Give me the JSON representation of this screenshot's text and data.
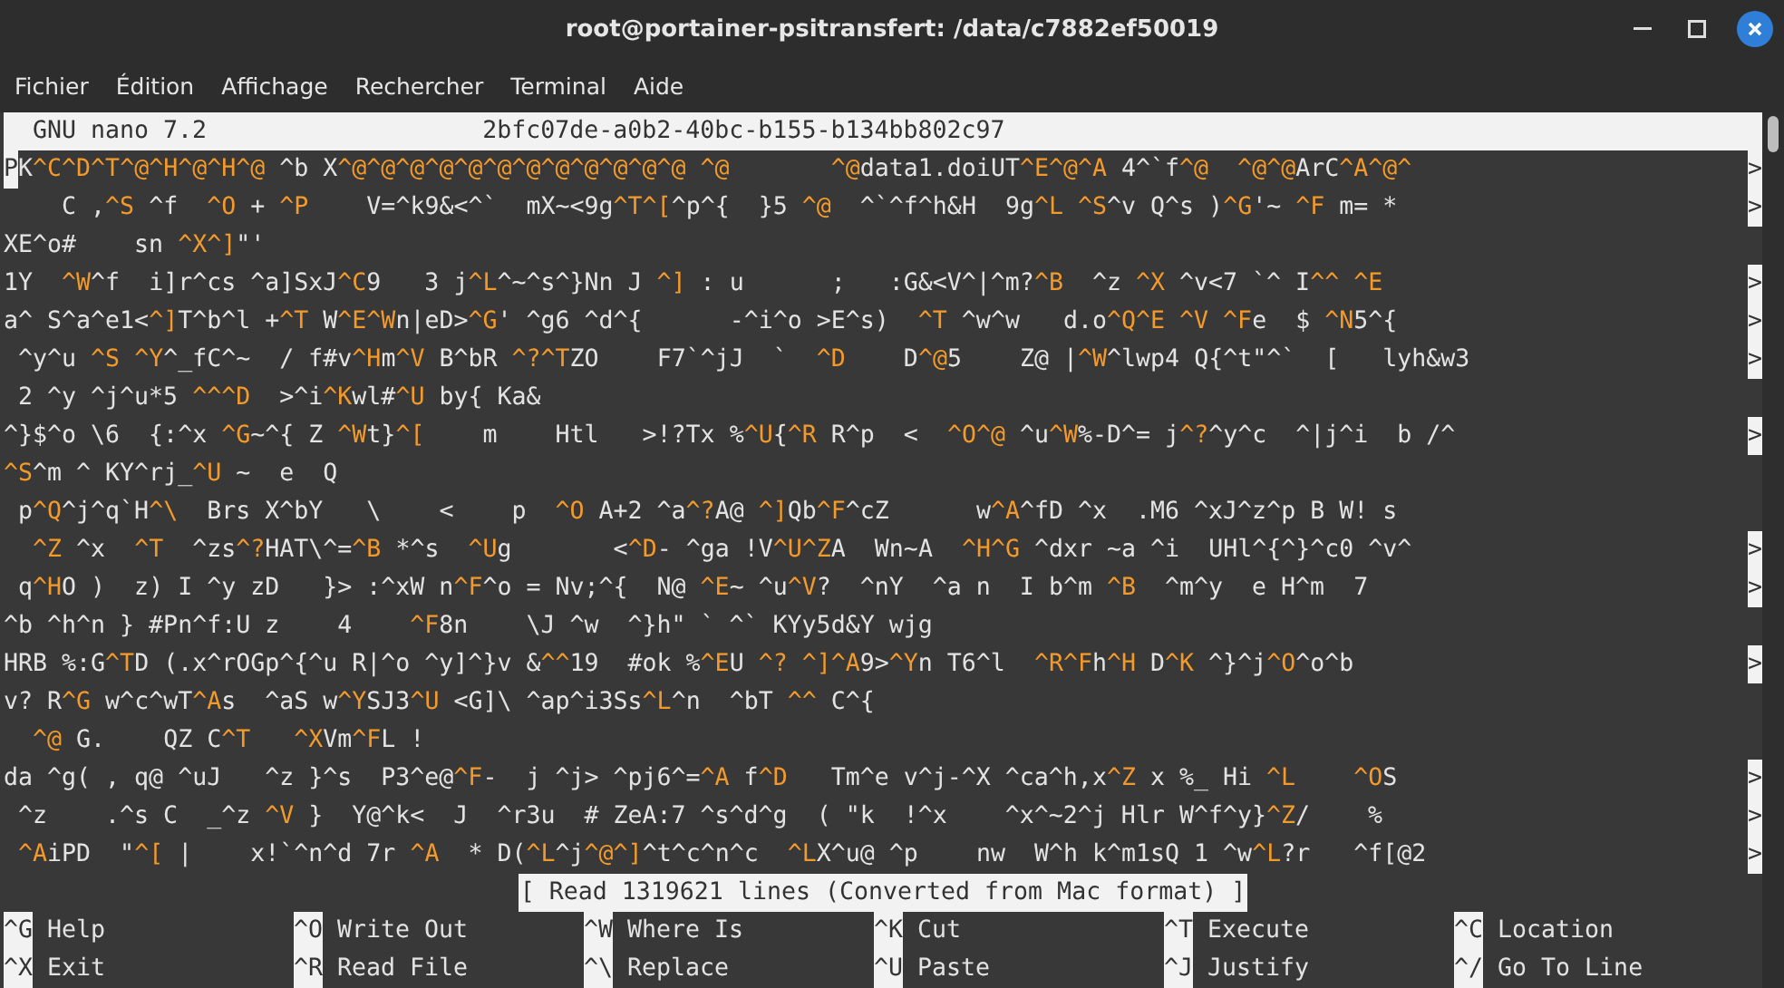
{
  "window": {
    "title": "root@portainer-psitransfert: /data/c7882ef50019"
  },
  "menu": [
    {
      "label": "Fichier"
    },
    {
      "label": "Édition"
    },
    {
      "label": "Affichage"
    },
    {
      "label": "Rechercher"
    },
    {
      "label": "Terminal"
    },
    {
      "label": "Aide"
    }
  ],
  "nano_header": {
    "version": "GNU nano 7.2",
    "filename": "2bfc07de-a0b2-40bc-b155-b134bb802c97"
  },
  "lines": [
    {
      "more": true,
      "segments": [
        {
          "kind": "cursor",
          "text": "P"
        },
        {
          "kind": "text",
          "text": "K"
        },
        {
          "kind": "ctrl",
          "text": "^C^D^T^@^H^@^H^@"
        },
        {
          "kind": "text",
          "text": " ^b X"
        },
        {
          "kind": "ctrl",
          "text": "^@^@^@^@^@^@^@^@^@^@^@^@"
        },
        {
          "kind": "ctrl",
          "text": " ^@"
        },
        {
          "kind": "ctrl",
          "text": "       ^@"
        },
        {
          "kind": "text",
          "text": "data1.doiUT"
        },
        {
          "kind": "ctrl",
          "text": "^E^@^A"
        },
        {
          "kind": "text",
          "text": " 4^`f"
        },
        {
          "kind": "ctrl",
          "text": "^@"
        },
        {
          "kind": "ctrl",
          "text": "  ^@^@"
        },
        {
          "kind": "text",
          "text": "ArC"
        },
        {
          "kind": "ctrl",
          "text": "^A^@^"
        }
      ]
    },
    {
      "more": true,
      "segments": [
        {
          "kind": "text",
          "text": "    C ,"
        },
        {
          "kind": "ctrl",
          "text": "^S"
        },
        {
          "kind": "text",
          "text": " ^f  "
        },
        {
          "kind": "ctrl",
          "text": "^O"
        },
        {
          "kind": "text",
          "text": " + "
        },
        {
          "kind": "ctrl",
          "text": "^P"
        },
        {
          "kind": "text",
          "text": "    V=^k9&<^`  mX~<9g"
        },
        {
          "kind": "ctrl",
          "text": "^T^["
        },
        {
          "kind": "text",
          "text": "^p^{  }5 "
        },
        {
          "kind": "ctrl",
          "text": "^@"
        },
        {
          "kind": "text",
          "text": "  ^`^f^h&H  9g"
        },
        {
          "kind": "ctrl",
          "text": "^L"
        },
        {
          "kind": "ctrl",
          "text": " ^S"
        },
        {
          "kind": "text",
          "text": "^v Q^s )"
        },
        {
          "kind": "ctrl",
          "text": "^G"
        },
        {
          "kind": "text",
          "text": "'~ "
        },
        {
          "kind": "ctrl",
          "text": "^F"
        },
        {
          "kind": "text",
          "text": " m= *"
        }
      ]
    },
    {
      "more": false,
      "segments": [
        {
          "kind": "text",
          "text": "XE^o#    sn "
        },
        {
          "kind": "ctrl",
          "text": "^X^]"
        },
        {
          "kind": "text",
          "text": "\"'"
        }
      ]
    },
    {
      "more": true,
      "segments": [
        {
          "kind": "text",
          "text": "1Y  "
        },
        {
          "kind": "ctrl",
          "text": "^W"
        },
        {
          "kind": "text",
          "text": "^f  i]r^cs ^a]SxJ"
        },
        {
          "kind": "ctrl",
          "text": "^C"
        },
        {
          "kind": "text",
          "text": "9   3 j"
        },
        {
          "kind": "ctrl",
          "text": "^L"
        },
        {
          "kind": "text",
          "text": "^~^s^}Nn J "
        },
        {
          "kind": "ctrl",
          "text": "^]"
        },
        {
          "kind": "text",
          "text": " : u      ;   :G&<V^|^m?"
        },
        {
          "kind": "ctrl",
          "text": "^B"
        },
        {
          "kind": "text",
          "text": "  ^z "
        },
        {
          "kind": "ctrl",
          "text": "^X"
        },
        {
          "kind": "text",
          "text": " ^v<7 `^ I"
        },
        {
          "kind": "ctrl",
          "text": "^^"
        },
        {
          "kind": "ctrl",
          "text": " ^E"
        }
      ]
    },
    {
      "more": true,
      "segments": [
        {
          "kind": "text",
          "text": "a^ S^a^e1<"
        },
        {
          "kind": "ctrl",
          "text": "^]"
        },
        {
          "kind": "text",
          "text": "T^b^l +"
        },
        {
          "kind": "ctrl",
          "text": "^T"
        },
        {
          "kind": "text",
          "text": " W"
        },
        {
          "kind": "ctrl",
          "text": "^E^W"
        },
        {
          "kind": "text",
          "text": "n|eD>"
        },
        {
          "kind": "ctrl",
          "text": "^G"
        },
        {
          "kind": "text",
          "text": "' ^g6 ^d^{      -^i^o >E^s)  "
        },
        {
          "kind": "ctrl",
          "text": "^T"
        },
        {
          "kind": "text",
          "text": " ^w^w   d.o"
        },
        {
          "kind": "ctrl",
          "text": "^Q^E"
        },
        {
          "kind": "ctrl",
          "text": " ^V"
        },
        {
          "kind": "ctrl",
          "text": " ^F"
        },
        {
          "kind": "text",
          "text": "e  $ "
        },
        {
          "kind": "ctrl",
          "text": "^N"
        },
        {
          "kind": "text",
          "text": "5^{ "
        }
      ]
    },
    {
      "more": true,
      "segments": [
        {
          "kind": "text",
          "text": " ^y^u "
        },
        {
          "kind": "ctrl",
          "text": "^S"
        },
        {
          "kind": "ctrl",
          "text": " ^Y"
        },
        {
          "kind": "text",
          "text": "^_fC^~  / f#v"
        },
        {
          "kind": "ctrl",
          "text": "^H"
        },
        {
          "kind": "text",
          "text": "m"
        },
        {
          "kind": "ctrl",
          "text": "^V"
        },
        {
          "kind": "text",
          "text": " B^bR "
        },
        {
          "kind": "ctrl",
          "text": "^?^T"
        },
        {
          "kind": "text",
          "text": "ZO    F7`^jJ  `  "
        },
        {
          "kind": "ctrl",
          "text": "^D"
        },
        {
          "kind": "text",
          "text": "    D"
        },
        {
          "kind": "ctrl",
          "text": "^@"
        },
        {
          "kind": "text",
          "text": "5    Z@ |"
        },
        {
          "kind": "ctrl",
          "text": "^W"
        },
        {
          "kind": "text",
          "text": "^lwp4 Q{^t\"^`  [   lyh&w3"
        }
      ]
    },
    {
      "more": false,
      "segments": [
        {
          "kind": "text",
          "text": " 2 ^y ^j^u*5 "
        },
        {
          "kind": "ctrl",
          "text": "^^^D"
        },
        {
          "kind": "text",
          "text": "  >^i"
        },
        {
          "kind": "ctrl",
          "text": "^K"
        },
        {
          "kind": "text",
          "text": "wl#"
        },
        {
          "kind": "ctrl",
          "text": "^U"
        },
        {
          "kind": "text",
          "text": " by{ Ka&"
        }
      ]
    },
    {
      "more": true,
      "segments": [
        {
          "kind": "text",
          "text": "^}$^o \\6  {:^x "
        },
        {
          "kind": "ctrl",
          "text": "^G"
        },
        {
          "kind": "text",
          "text": "~^{ Z "
        },
        {
          "kind": "ctrl",
          "text": "^W"
        },
        {
          "kind": "text",
          "text": "t}"
        },
        {
          "kind": "ctrl",
          "text": "^["
        },
        {
          "kind": "text",
          "text": "    m    Htl   >!?Tx %"
        },
        {
          "kind": "ctrl",
          "text": "^U"
        },
        {
          "kind": "text",
          "text": "{"
        },
        {
          "kind": "ctrl",
          "text": "^R"
        },
        {
          "kind": "text",
          "text": " R^p  <  "
        },
        {
          "kind": "ctrl",
          "text": "^O^@"
        },
        {
          "kind": "text",
          "text": " ^u"
        },
        {
          "kind": "ctrl",
          "text": "^W"
        },
        {
          "kind": "text",
          "text": "%-D^= j"
        },
        {
          "kind": "ctrl",
          "text": "^?"
        },
        {
          "kind": "text",
          "text": "^y^c  ^|j^i  b /^"
        }
      ]
    },
    {
      "more": false,
      "segments": [
        {
          "kind": "ctrl",
          "text": "^S"
        },
        {
          "kind": "text",
          "text": "^m ^ KY^rj_"
        },
        {
          "kind": "ctrl",
          "text": "^U"
        },
        {
          "kind": "text",
          "text": " ~  e  Q"
        }
      ]
    },
    {
      "more": false,
      "segments": [
        {
          "kind": "text",
          "text": " p"
        },
        {
          "kind": "ctrl",
          "text": "^Q"
        },
        {
          "kind": "text",
          "text": "^j^q`H"
        },
        {
          "kind": "ctrl",
          "text": "^\\"
        },
        {
          "kind": "text",
          "text": "  Brs X^bY   \\    <    p  "
        },
        {
          "kind": "ctrl",
          "text": "^O"
        },
        {
          "kind": "text",
          "text": " A+2 ^a"
        },
        {
          "kind": "ctrl",
          "text": "^?"
        },
        {
          "kind": "text",
          "text": "A@ "
        },
        {
          "kind": "ctrl",
          "text": "^]"
        },
        {
          "kind": "text",
          "text": "Qb"
        },
        {
          "kind": "ctrl",
          "text": "^F"
        },
        {
          "kind": "text",
          "text": "^cZ      w"
        },
        {
          "kind": "ctrl",
          "text": "^A"
        },
        {
          "kind": "text",
          "text": "^fD ^x  .M6 ^xJ^z^p B W! s"
        }
      ]
    },
    {
      "more": true,
      "segments": [
        {
          "kind": "ctrl",
          "text": "  ^Z"
        },
        {
          "kind": "text",
          "text": " ^x  "
        },
        {
          "kind": "ctrl",
          "text": "^T"
        },
        {
          "kind": "text",
          "text": "  ^zs"
        },
        {
          "kind": "ctrl",
          "text": "^?"
        },
        {
          "kind": "text",
          "text": "HAT\\^="
        },
        {
          "kind": "ctrl",
          "text": "^B"
        },
        {
          "kind": "text",
          "text": " *^s  "
        },
        {
          "kind": "ctrl",
          "text": "^U"
        },
        {
          "kind": "text",
          "text": "g       <"
        },
        {
          "kind": "ctrl",
          "text": "^D"
        },
        {
          "kind": "text",
          "text": "- ^ga !V"
        },
        {
          "kind": "ctrl",
          "text": "^U^Z"
        },
        {
          "kind": "text",
          "text": "A  Wn~A  "
        },
        {
          "kind": "ctrl",
          "text": "^H^G"
        },
        {
          "kind": "text",
          "text": " ^dxr ~a ^i  UHl^{^}^c0 ^v^"
        }
      ]
    },
    {
      "more": true,
      "segments": [
        {
          "kind": "text",
          "text": " q"
        },
        {
          "kind": "ctrl",
          "text": "^H"
        },
        {
          "kind": "text",
          "text": "O )  z) I ^y zD   }> :^xW n"
        },
        {
          "kind": "ctrl",
          "text": "^F"
        },
        {
          "kind": "text",
          "text": "^o = Nv;^{  N@ "
        },
        {
          "kind": "ctrl",
          "text": "^E"
        },
        {
          "kind": "text",
          "text": "~ ^u"
        },
        {
          "kind": "ctrl",
          "text": "^V"
        },
        {
          "kind": "text",
          "text": "?  ^nY  ^a n  I b^m "
        },
        {
          "kind": "ctrl",
          "text": "^B"
        },
        {
          "kind": "text",
          "text": "  ^m^y  e H^m  7 "
        }
      ]
    },
    {
      "more": false,
      "segments": [
        {
          "kind": "text",
          "text": "^b ^h^n } #Pn^f:U z    4    "
        },
        {
          "kind": "ctrl",
          "text": "^F"
        },
        {
          "kind": "text",
          "text": "8n    \\J ^w  ^}h\" ` ^` KYy5d&Y wjg"
        }
      ]
    },
    {
      "more": true,
      "segments": [
        {
          "kind": "text",
          "text": "HRB %:G"
        },
        {
          "kind": "ctrl",
          "text": "^T"
        },
        {
          "kind": "text",
          "text": "D (.x^rOGp^{^u R|^o ^y]^}v &"
        },
        {
          "kind": "ctrl",
          "text": "^^"
        },
        {
          "kind": "text",
          "text": "19  #ok %"
        },
        {
          "kind": "ctrl",
          "text": "^E"
        },
        {
          "kind": "text",
          "text": "U "
        },
        {
          "kind": "ctrl",
          "text": "^? ^]^A"
        },
        {
          "kind": "text",
          "text": "9>"
        },
        {
          "kind": "ctrl",
          "text": "^Y"
        },
        {
          "kind": "text",
          "text": "n T6^l  "
        },
        {
          "kind": "ctrl",
          "text": "^R^F"
        },
        {
          "kind": "text",
          "text": "h"
        },
        {
          "kind": "ctrl",
          "text": "^H"
        },
        {
          "kind": "text",
          "text": " D"
        },
        {
          "kind": "ctrl",
          "text": "^K"
        },
        {
          "kind": "text",
          "text": " ^}^j"
        },
        {
          "kind": "ctrl",
          "text": "^O"
        },
        {
          "kind": "text",
          "text": "^o^b "
        }
      ]
    },
    {
      "more": false,
      "segments": [
        {
          "kind": "text",
          "text": "v? R"
        },
        {
          "kind": "ctrl",
          "text": "^G"
        },
        {
          "kind": "text",
          "text": " w^c^wT"
        },
        {
          "kind": "ctrl",
          "text": "^A"
        },
        {
          "kind": "text",
          "text": "s  ^aS w"
        },
        {
          "kind": "ctrl",
          "text": "^Y"
        },
        {
          "kind": "text",
          "text": "SJ3"
        },
        {
          "kind": "ctrl",
          "text": "^U"
        },
        {
          "kind": "text",
          "text": " <G]\\ ^ap^i3Ss"
        },
        {
          "kind": "ctrl",
          "text": "^L"
        },
        {
          "kind": "text",
          "text": "^n  ^bT "
        },
        {
          "kind": "ctrl",
          "text": "^^"
        },
        {
          "kind": "text",
          "text": " C^{"
        }
      ]
    },
    {
      "more": false,
      "segments": [
        {
          "kind": "ctrl",
          "text": "  ^@"
        },
        {
          "kind": "text",
          "text": " G.    QZ C"
        },
        {
          "kind": "ctrl",
          "text": "^T"
        },
        {
          "kind": "ctrl",
          "text": "   ^X"
        },
        {
          "kind": "text",
          "text": "Vm"
        },
        {
          "kind": "ctrl",
          "text": "^F"
        },
        {
          "kind": "text",
          "text": "L !"
        }
      ]
    },
    {
      "more": true,
      "segments": [
        {
          "kind": "text",
          "text": "da ^g( , q@ ^uJ   ^z }^s  P3^e@"
        },
        {
          "kind": "ctrl",
          "text": "^F"
        },
        {
          "kind": "text",
          "text": "-  j ^j> ^pj6^="
        },
        {
          "kind": "ctrl",
          "text": "^A"
        },
        {
          "kind": "text",
          "text": " f"
        },
        {
          "kind": "ctrl",
          "text": "^D"
        },
        {
          "kind": "text",
          "text": "   Tm^e v^j-^X ^ca^h,x"
        },
        {
          "kind": "ctrl",
          "text": "^Z"
        },
        {
          "kind": "text",
          "text": " x %_ Hi "
        },
        {
          "kind": "ctrl",
          "text": "^L"
        },
        {
          "kind": "ctrl",
          "text": "    ^O"
        },
        {
          "kind": "text",
          "text": "S "
        }
      ]
    },
    {
      "more": true,
      "segments": [
        {
          "kind": "text",
          "text": " ^z    .^s C  _^z "
        },
        {
          "kind": "ctrl",
          "text": "^V"
        },
        {
          "kind": "text",
          "text": " }  Y@^k<  J  ^r3u  # ZeA:7 ^s^d^g  ( \"k  !^x    ^x^~2^j Hlr W^f^y}"
        },
        {
          "kind": "ctrl",
          "text": "^Z"
        },
        {
          "kind": "text",
          "text": "/    %  "
        }
      ]
    },
    {
      "more": true,
      "segments": [
        {
          "kind": "ctrl",
          "text": " ^A"
        },
        {
          "kind": "text",
          "text": "iPD  \""
        },
        {
          "kind": "ctrl",
          "text": "^["
        },
        {
          "kind": "text",
          "text": " |    x!`^n^d 7r "
        },
        {
          "kind": "ctrl",
          "text": "^A"
        },
        {
          "kind": "text",
          "text": "  * D("
        },
        {
          "kind": "ctrl",
          "text": "^L"
        },
        {
          "kind": "text",
          "text": "^j"
        },
        {
          "kind": "ctrl",
          "text": "^@^]"
        },
        {
          "kind": "text",
          "text": "^t^c^n^c  "
        },
        {
          "kind": "ctrl",
          "text": "^L"
        },
        {
          "kind": "text",
          "text": "X^u@ ^p    nw  W^h k^m1sQ 1 ^w"
        },
        {
          "kind": "ctrl",
          "text": "^L"
        },
        {
          "kind": "text",
          "text": "?r   ^f[@2"
        }
      ]
    }
  ],
  "more_marker": ">",
  "status": "[ Read 1319621 lines (Converted from Mac format) ]",
  "shortcuts": [
    {
      "key": "^G",
      "label": "Help"
    },
    {
      "key": "^O",
      "label": "Write Out"
    },
    {
      "key": "^W",
      "label": "Where Is"
    },
    {
      "key": "^K",
      "label": "Cut"
    },
    {
      "key": "^T",
      "label": "Execute"
    },
    {
      "key": "^C",
      "label": "Location"
    },
    {
      "key": "^X",
      "label": "Exit"
    },
    {
      "key": "^R",
      "label": "Read File"
    },
    {
      "key": "^\\",
      "label": "Replace"
    },
    {
      "key": "^U",
      "label": "Paste"
    },
    {
      "key": "^J",
      "label": "Justify"
    },
    {
      "key": "^/",
      "label": "Go To Line"
    }
  ]
}
